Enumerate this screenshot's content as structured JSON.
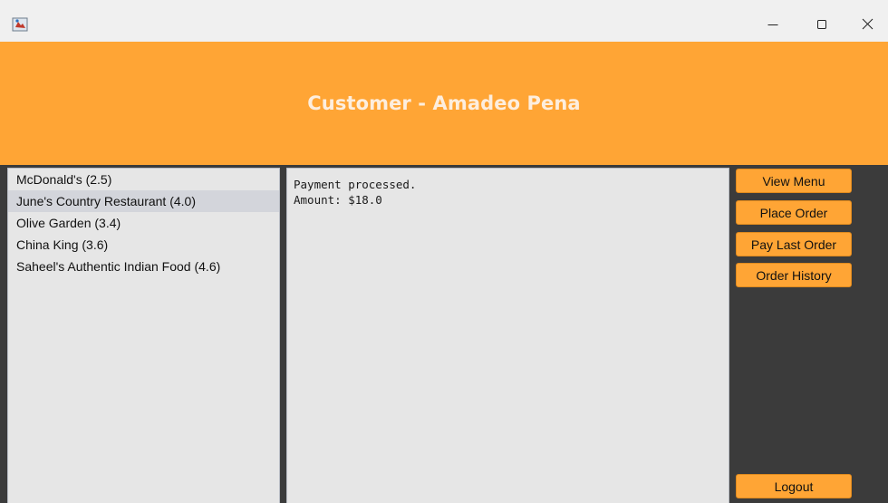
{
  "window": {
    "app_icon": "java-app-icon",
    "controls": {
      "minimize_icon": "minimize-icon",
      "maximize_icon": "maximize-icon",
      "close_icon": "close-icon"
    }
  },
  "header": {
    "title": "Customer - Amadeo Pena"
  },
  "restaurants": {
    "items": [
      {
        "label": "McDonald's (2.5)",
        "selected": false
      },
      {
        "label": "June's Country Restaurant (4.0)",
        "selected": true
      },
      {
        "label": "Olive Garden (3.4)",
        "selected": false
      },
      {
        "label": "China King (3.6)",
        "selected": false
      },
      {
        "label": "Saheel's Authentic Indian Food (4.6)",
        "selected": false
      }
    ]
  },
  "output": {
    "lines": [
      "Payment processed.",
      "Amount: $18.0"
    ]
  },
  "actions": {
    "view_menu": "View Menu",
    "place_order": "Place Order",
    "pay_last_order": "Pay Last Order",
    "order_history": "Order History",
    "logout": "Logout"
  },
  "colors": {
    "accent": "#ffa535",
    "header_text": "#fdeede",
    "sidebar_bg": "#3b3b3b",
    "panel_bg": "#e6e6e6",
    "selection": "#d3d5db"
  }
}
